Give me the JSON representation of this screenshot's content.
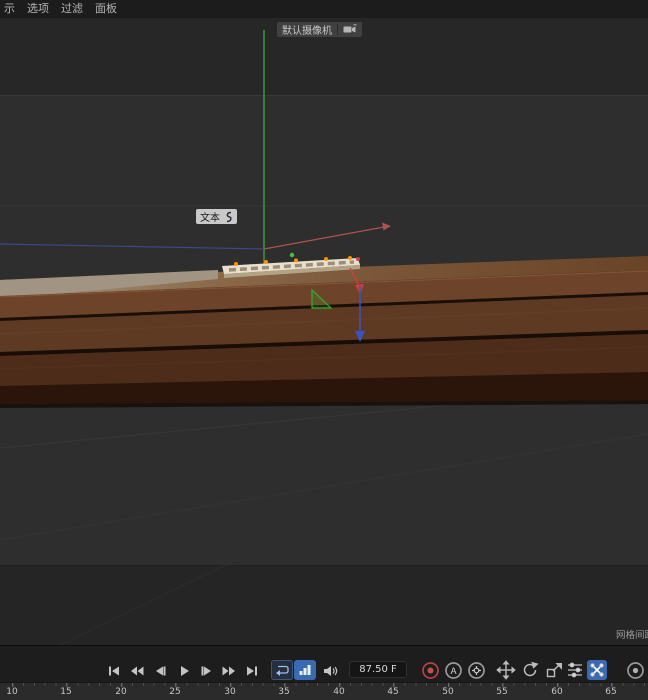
{
  "menu": {
    "items": [
      "示",
      "选项",
      "过滤",
      "面板"
    ]
  },
  "viewport": {
    "camera_label": "默认摄像机",
    "object_label": "文本",
    "grid_spacing_label": "网格间距"
  },
  "timeline": {
    "frame_display": "87.50 F",
    "ruler_labels": [
      "10",
      "15",
      "20",
      "25",
      "30",
      "35",
      "40",
      "45",
      "50",
      "55",
      "60",
      "65"
    ],
    "autokey_letter": "A"
  },
  "icons": {
    "transport": [
      "goto-start",
      "goto-prev-key",
      "goto-prev-frame",
      "play",
      "goto-next-frame",
      "goto-next-key",
      "goto-end"
    ],
    "playback_toggles": [
      "loop-playback",
      "keyframe-ramp"
    ],
    "sound": "speaker",
    "record_group": [
      "record-keyframe",
      "autokeying",
      "keyframe-selection"
    ],
    "key_type_toggles": [
      "record-position",
      "record-rotation",
      "record-scale",
      "record-parameter",
      "record-pla"
    ],
    "right_end": "solo-circle",
    "hud": [
      "camera-icon",
      "text-spline-icon"
    ]
  },
  "colors": {
    "accent_blue": "#3a6ab2",
    "axis_green": "#3f9f3f",
    "axis_red": "#b05252",
    "axis_blue": "#3b52c4",
    "record_red": "#b24444",
    "wood_light": "#6d432a",
    "wood_mid": "#5e3a23",
    "wood_dark": "#4d2d19",
    "viewport_bg": "#2e2e2e"
  }
}
